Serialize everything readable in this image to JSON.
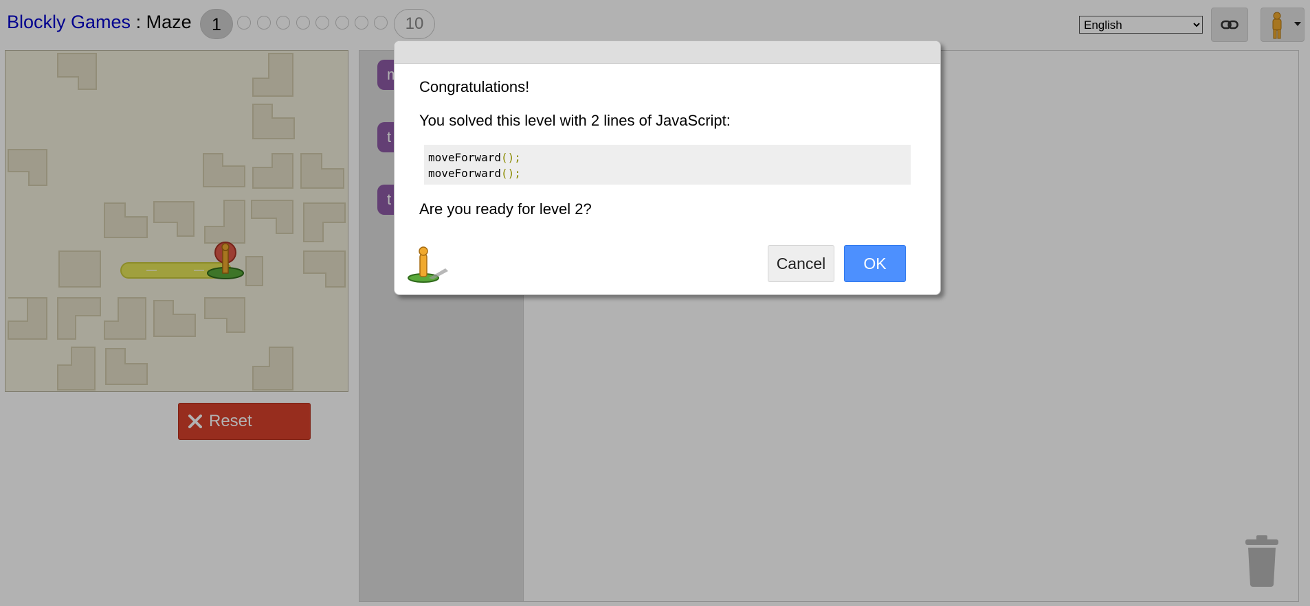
{
  "header": {
    "app_title": "Blockly Games",
    "separator": " : ",
    "game_title": "Maze",
    "current_level": "1",
    "last_level": "10",
    "language": "English",
    "language_options": [
      "English"
    ]
  },
  "icons": {
    "link": "link-icon",
    "pegman": "pegman-icon",
    "reset": "x-icon",
    "trash": "trash-icon"
  },
  "maze": {
    "reset_label": "Reset"
  },
  "toolbox": {
    "blocks": [
      "m",
      "t",
      "t"
    ]
  },
  "dialog": {
    "heading": "Congratulations!",
    "message": "You solved this level with 2 lines of JavaScript:",
    "code_lines": [
      {
        "fn": "moveForward",
        "punc": "();"
      },
      {
        "fn": "moveForward",
        "punc": "();"
      }
    ],
    "question": "Are you ready for level 2?",
    "cancel_label": "Cancel",
    "ok_label": "OK"
  },
  "colors": {
    "link": "#0000cc",
    "reset_button": "#d9412b",
    "ok_button": "#4d90fe",
    "block_purple": "#8e5ba6",
    "maze_floor": "#f1eedc",
    "maze_path": "#e6e65a"
  }
}
